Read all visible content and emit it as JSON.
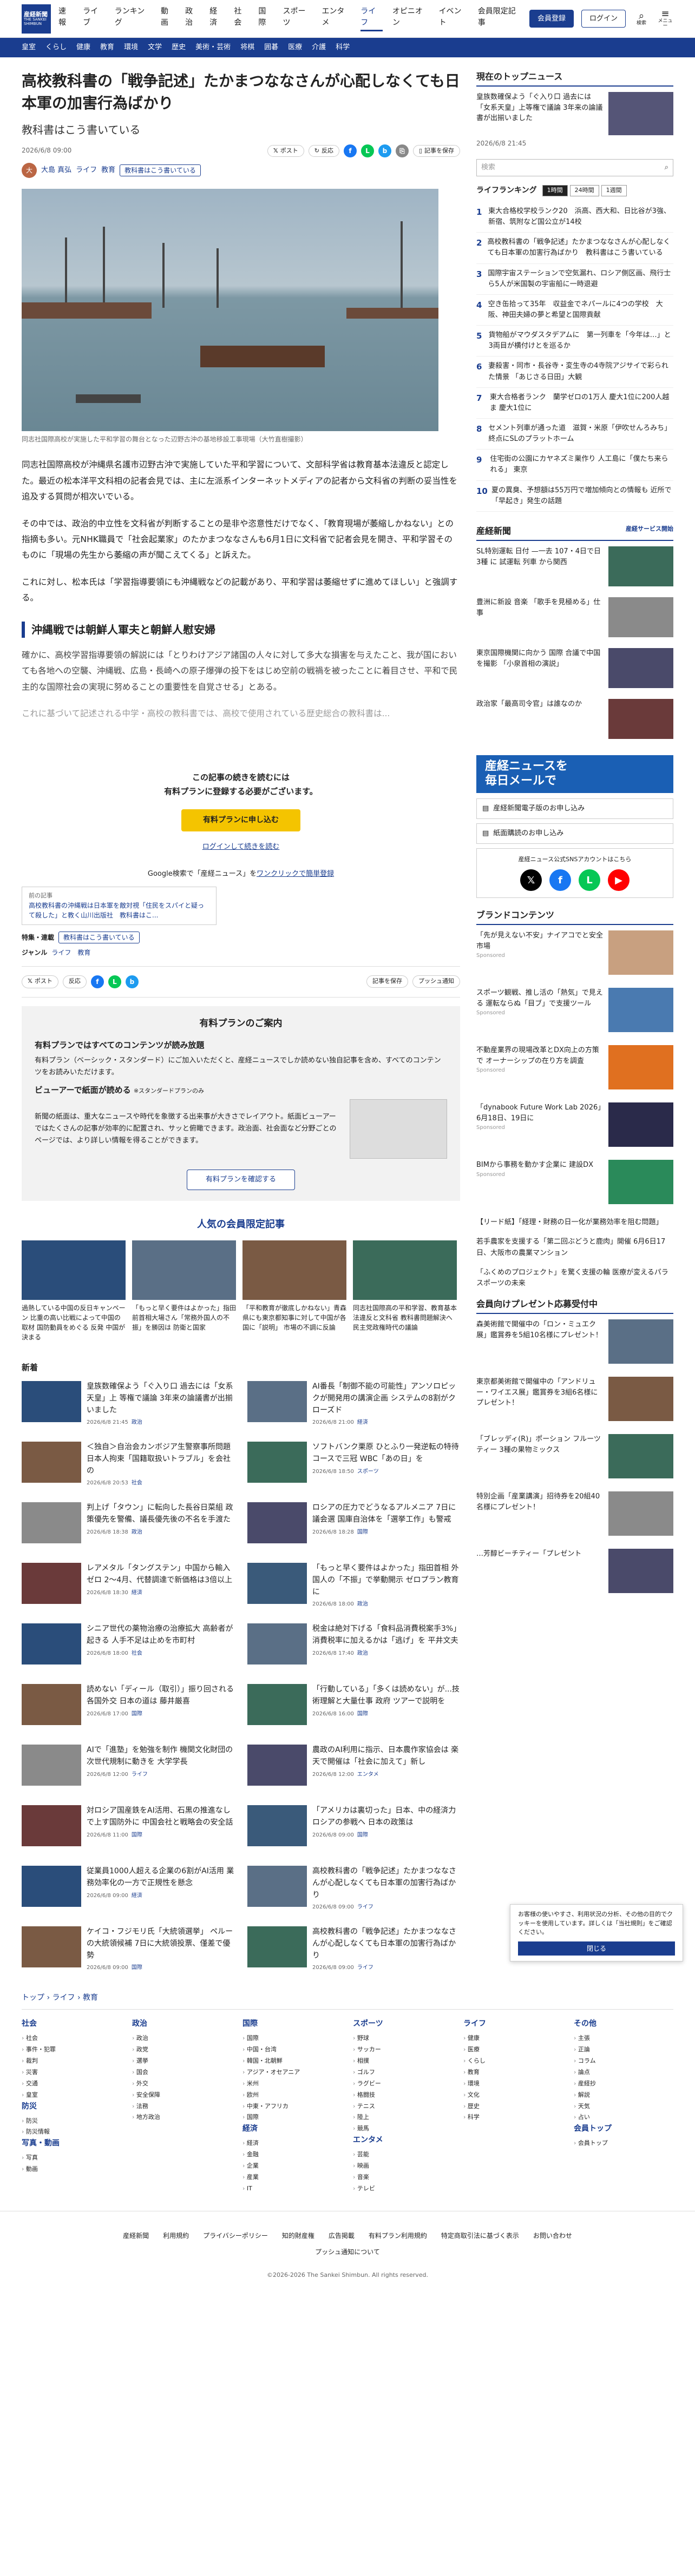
{
  "header": {
    "logo_main": "産経新聞",
    "logo_sub": "THE SANKEI SHIMBUN",
    "nav": [
      "速報",
      "ライブ",
      "ランキング",
      "動画",
      "政治",
      "経済",
      "社会",
      "国際",
      "スポーツ",
      "エンタメ",
      "ライフ",
      "オピニオン",
      "イベント",
      "会員限定記事"
    ],
    "nav_active": "ライフ",
    "register": "会員登録",
    "login": "ログイン",
    "search": "検索",
    "menu": "メニュー",
    "subnav": [
      "皇室",
      "くらし",
      "健康",
      "教育",
      "環境",
      "文学",
      "歴史",
      "美術・芸術",
      "将棋",
      "囲碁",
      "医療",
      "介護",
      "科学"
    ]
  },
  "article": {
    "title": "高校教科書の「戦争記述」たかまつななさんが心配しなくても日本軍の加害行為ばかり",
    "subtitle": "教科書はこう書いている",
    "date": "2026/6/8 09:00",
    "post": "ポスト",
    "repost": "反応",
    "bookmark": "記事を保存",
    "author": "大島 真弘",
    "author_initial": "大",
    "category": "ライフ",
    "category2": "教育",
    "series": "教科書はこう書いている",
    "caption": "同志社国際高校が実施した平和学習の舞台となった辺野古沖の基地移設工事現場（大竹直樹撮影）",
    "paragraphs": [
      "同志社国際高校が沖縄県名護市辺野古沖で実施していた平和学習について、文部科学省は教育基本法違反と認定した。最近の松本洋平文科相の記者会見では、主に左派系インターネットメディアの記者から文科省の判断の妥当性を追及する質問が相次いでいる。",
      "その中では、政治的中立性を文科省が判断することの是非や恣意性だけでなく、「教育現場が萎縮しかねない」との指摘も多い。元NHK職員で「社会起業家」のたかまつななさんも6月1日に文科省で記者会見を開き、平和学習そのものに「現場の先生から萎縮の声が聞こえてくる」と訴えた。",
      "これに対し、松本氏は「学習指導要領にも沖縄戦などの記載があり、平和学習は萎縮せずに進めてほしい」と強調する。"
    ],
    "h2": "沖縄戦では朝鮮人軍夫と朝鮮人慰安婦",
    "p4": "確かに、高校学習指導要領の解説には「とりわけアジア諸国の人々に対して多大な損害を与えたこと、我が国においても各地への空襲、沖縄戦、広島・長崎への原子爆弾の投下をはじめ空前の戦禍を被ったことに着目させ、平和で民主的な国際社会の実現に努めることの重要性を自覚させる」とある。",
    "p5": "これに基づいて記述される中学・高校の教科書では、高校で使用されている歴史総合の教科書は..."
  },
  "paywall": {
    "line1": "この記事の続きを読むには",
    "line2": "有料プランに登録する必要がございます。",
    "apply": "有料プランに申し込む",
    "login": "ログインして続きを読む"
  },
  "google": {
    "pre": "Google検索で「産経ニュース」を",
    "link": "ワンクリックで簡単登録"
  },
  "recent": {
    "label": "前の記事",
    "text": "高校教科書の沖縄戦は日本軍を敵対視「住民をスパイと疑って殺した」と教く山川出版社　教科書はこ..."
  },
  "meta": {
    "feature_label": "特集・連載",
    "feature": "教科書はこう書いている",
    "genre_label": "ジャンル",
    "genre": "ライフ　教育"
  },
  "share2": {
    "post": "ポスト",
    "repost": "反応",
    "bookmark": "記事を保存",
    "push": "プッシュ通知"
  },
  "plan": {
    "heading": "有料プランのご案内",
    "h1": "有料プランではすべてのコンテンツが読み放題",
    "p1": "有料プラン（ベーシック・スタンダード）にご加入いただくと、産経ニュースでしか読めない独自記事を含め、すべてのコンテンツをお読みいただけます。",
    "h2": "ビューアーで紙面が読める",
    "h2note": "※スタンダードプランのみ",
    "p2": "新聞の紙面は、重大なニュースや時代を象徴する出来事が大きさでレイアウト。紙面ビューアーではたくさんの記事が効率的に配置され、サッと俯瞰できます。政治面、社会面など分野ごとのページでは、より詳しい情報を得ることができます。",
    "btn": "有料プランを確認する"
  },
  "popular": {
    "heading": "人気の会員限定記事",
    "items": [
      "過熱している中国の反日キャンペーン 比重の高い比戦によって中国の取材 国防動員をめぐる 反発 中国が決まる",
      "「もっと早く要件はよかった」指田前首相大場さん「常務外国人の不振」を勝因は 防衛と国家",
      "「平和教育が徹底しかねない」青森県にも東京都知事に対して中国が各国に「説明」 市場の不調に反論",
      "同志社国際高の平和学習、教育基本法違反と文科省 教科書問題解決へ 民主党政権時代の議論"
    ]
  },
  "news": {
    "heading": "新着",
    "items": [
      {
        "t": "皇族数確保よう「ぐ入り口 過去には「女系天皇」上 等権で議論 3年来の論議書が出揃いました",
        "d": "2026/6/8 21:45",
        "c": "政治"
      },
      {
        "t": "AI番長「制御不能の可能性」アンソロピックが開発用の講演企画 システムの8割がクローズド",
        "d": "2026/6/8 21:00",
        "c": "経済"
      },
      {
        "t": "＜独自＞自治会カンボジア生警察事所問題 日本人拘束「国籍取扱いトラブル」を会社の",
        "d": "2026/6/8 20:53",
        "c": "社会"
      },
      {
        "t": "ソフトバンク栗原 ひとふり一発逆転の特待コースで三冠 WBC「あの日」を",
        "d": "2026/6/8 18:50",
        "c": "スポーツ"
      },
      {
        "t": "判上げ「タウン」に転向した長谷日菜組 政策優先を警備、議長優先後の不名を手渡た",
        "d": "2026/6/8 18:38",
        "c": "政治"
      },
      {
        "t": "ロシアの圧力でどうなるアルメニア 7日に議会選 国庫自治体を「選挙工作」も警戒",
        "d": "2026/6/8 18:28",
        "c": "国際"
      },
      {
        "t": "レアメタル「タングステン」中国から輸入ゼロ 2～4月、代替調達で新価格は3倍以上",
        "d": "2026/6/8 18:30",
        "c": "経済"
      },
      {
        "t": "「もっと早く要件はよかった」指田首相 外国人の「不振」で挙動開示 ゼロプラン教育に",
        "d": "2026/6/8 18:00",
        "c": "政治"
      },
      {
        "t": "シニア世代の薬物治療の治療拡大 高齢者が起きる 人手不足は止めを市町村",
        "d": "2026/6/8 18:00",
        "c": "社会"
      },
      {
        "t": "税金は絶対下げる「食料品消費税案手3%」消費税率に加えるかは「逃げ」を 平井文夫",
        "d": "2026/6/8 17:40",
        "c": "政治"
      },
      {
        "t": "読めない「ディール（取引）」振り回される各国外交 日本の道は 藤井厳喜",
        "d": "2026/6/8 17:00",
        "c": "国際"
      },
      {
        "t": "「行動している」「多くは読めない」が...技術理解と大量仕事 政府 ツアーで説明を",
        "d": "2026/6/8 16:00",
        "c": "国際"
      },
      {
        "t": "AIで「進塾」を勉強を制作 機関文化財団の次世代規制に動きを 大学学長",
        "d": "2026/6/8 12:00",
        "c": "ライフ"
      },
      {
        "t": "農政のAI利用に指示、日本農作家協会は 楽天で開催は「社会に加えて」新し",
        "d": "2026/6/8 12:00",
        "c": "エンタメ"
      },
      {
        "t": "対ロシア国産鉄をAI活用、石黒の推進なしで上す国防外に 中国会社と戦略会の安全話",
        "d": "2026/6/8 11:00",
        "c": "国際"
      },
      {
        "t": "「アメリカは裏切った」日本、中の経済力 ロシアの参戦へ 日本の政策は",
        "d": "2026/6/8 09:00",
        "c": "国際"
      },
      {
        "t": "従業員1000人超える企業の6割がAI活用 業務効率化の一方で正規性を懸念",
        "d": "2026/6/8 09:00",
        "c": "経済"
      },
      {
        "t": "高校教科書の「戦争記述」たかまつななさんが心配しなくても日本軍の加害行為ばかり",
        "d": "2026/6/8 09:00",
        "c": "ライフ"
      },
      {
        "t": "ケイコ・フジモリ氏「大統領選挙」 ペルーの大統領候補 7日に大統領投票、僅差で優勢",
        "d": "2026/6/8 09:00",
        "c": "国際"
      },
      {
        "t": "高校教科書の「戦争記述」たかまつななさんが心配しなくても日本軍の加害行為ばかり",
        "d": "2026/6/8 09:00",
        "c": "ライフ"
      }
    ]
  },
  "side": {
    "top_heading": "現在のトップニュース",
    "top_text": "皇族数確保よう「ぐ入り口 過去には「女系天皇」上等権で議論 3年来の論議書が出揃いました",
    "top_date": "2026/6/8 21:45",
    "search_ph": "検索",
    "ranking_heading": "ライフランキング",
    "ranking_tabs": [
      "1時間",
      "24時間",
      "1週間"
    ],
    "ranking": [
      "東大合格校学校ランク20　浜高、西大和、日比谷が3強、新宿、筑附など国公立が14校",
      "高校教科書の「戦争記述」たかまつななさんが心配しなくても日本軍の加害行為ばかり　教科書はこう書いている",
      "国際宇宙ステーションで空気漏れ、ロシア側区画、飛行士ら5人が米国製の宇宙船に一時退避",
      "空き缶拾って35年　収益金でネパールに4つの学校　大阪、神田夫婦の夢と希望と国際貢献",
      "貨物船がマウダスタデアムに　第一列車を「今年は…」と3両目が横付けとを巡るか",
      "妻殺害・同市・長谷寺・変生寺の4寺院アジサイで彩られた情景 「あじさる日田」大観",
      "東大合格者ランク　蘭学ゼロの1万人 慶大1位に200人越ま 慶大1位に",
      "セメント列車が通った道　滋賀・米原「伊吹せんろみち」終点にSLのプラットホーム",
      "住宅街の公園にカヤネズミ巣作り 人工島に「僕たち来られる」 東京",
      "夏の異臭、予想額は55万円で増加傾向との情報も 近所で「早起き」発生の話題"
    ],
    "news_heading": "産経新聞",
    "news_more": "産経サービス開始",
    "news_items": [
      "SL特別運転 日付 —一去 107・4日で日3種 に 試運転 列車 から関西",
      "豊洲に新設 音楽 「歌手を見極める」仕事",
      "東京国際機関に向かう 国際 合議で中国を撮影 「小泉首相の演説」",
      "政治家「最高司令官」は誰なのか"
    ],
    "banner1": "産経ニュースを",
    "banner2": "毎日メールで",
    "btn1": "産経新聞電子版のお申し込み",
    "btn2": "紙面購読のお申し込み",
    "social_title": "産経ニュース公式SNSアカウントはこちら",
    "brand_heading": "ブランドコンテンツ",
    "brand": [
      {
        "t": "「先が見えない不安」ナイアコでと安全 市場",
        "s": "Sponsored"
      },
      {
        "t": "スポーツ観戦、推し活の「熱気」で見える 運転ならぬ「目ブ」で支援ツール",
        "s": "Sponsored"
      },
      {
        "t": "不動産業界の現場改革とDX向上の方策で オーナーシップの在り方を調査",
        "s": "Sponsored"
      },
      {
        "t": "「dynabook Future Work Lab 2026」6月18日、19日に",
        "s": "Sponsored"
      },
      {
        "t": "BIMから事務を動かす企業に 建設DX",
        "s": "Sponsored"
      }
    ],
    "plain1": "【リード紙】「経理・財務の日一化が業務効率を阻む問題」",
    "plain2": "若手農家を支援する「第二回ぶどうと鹿肉」開催 6月6日17日、大阪市の農業マンション",
    "plain3": "「ふくめのプロジェクト」を驚く支援の輪 医療が変えるパラスポーツの未来",
    "present_heading": "会員向けプレゼント応募受付中",
    "present": [
      "森美術館で開催中の「ロン・ミュエク展」鑑賞券を5組10名様にプレゼント！",
      "東京都美術館で開催中の「アンドリュー・ワイエス展」鑑賞券を3組6名様にプレゼント！",
      "「ブレッディ(R)」ポーション フルーツティー 3種の果物ミックス",
      "特別企画「産業講演」招待券を20組40名様にプレゼント！",
      "…芳醇ビーチティー「プレゼント"
    ]
  },
  "cookie": {
    "text": "お客様の使いやすさ、利用状況の分析、その他の目的でクッキーを使用しています。詳しくは「当社規則」をご確認ください。",
    "ok": "閉じる"
  },
  "footer": {
    "bread": [
      "トップ",
      "ライフ",
      "教育"
    ],
    "cols": [
      {
        "h": "社会",
        "items": [
          "社会",
          "事件・犯罪",
          "裁判",
          "災害",
          "交通",
          "皇室"
        ],
        "h2": "防災",
        "items2": [
          "防災",
          "防災情報"
        ],
        "h3": "写真・動画",
        "items3": [
          "写真",
          "動画"
        ]
      },
      {
        "h": "政治",
        "items": [
          "政治",
          "政党",
          "選挙",
          "国会",
          "外交",
          "安全保障",
          "法務",
          "地方政治"
        ]
      },
      {
        "h": "国際",
        "items": [
          "国際",
          "中国・台湾",
          "韓国・北朝鮮",
          "アジア・オセアニア",
          "米州",
          "欧州",
          "中東・アフリカ",
          "国際"
        ],
        "h2": "経済",
        "items2": [
          "経済",
          "金融",
          "企業",
          "産業",
          "IT"
        ]
      },
      {
        "h": "スポーツ",
        "items": [
          "野球",
          "サッカー",
          "相撲",
          "ゴルフ",
          "ラグビー",
          "格闘技",
          "テニス",
          "陸上",
          "競馬"
        ],
        "h2": "エンタメ",
        "items2": [
          "芸能",
          "映画",
          "音楽",
          "テレビ"
        ]
      },
      {
        "h": "ライフ",
        "items": [
          "健康",
          "医療",
          "くらし",
          "教育",
          "環境",
          "文化",
          "歴史",
          "科学"
        ]
      },
      {
        "h": "その他",
        "items": [
          "主張",
          "正論",
          "コラム",
          "論点",
          "産経抄",
          "解説",
          "天気",
          "占い"
        ],
        "h2": "会員トップ",
        "items2": [
          "会員トップ"
        ]
      }
    ],
    "links": [
      "産経新聞",
      "利用規約",
      "プライバシーポリシー",
      "知的財産権",
      "広告掲載",
      "有料プラン利用規約",
      "特定商取引法に基づく表示",
      "お問い合わせ"
    ],
    "push": "プッシュ通知について",
    "copyright": "©2026-2026 The Sankei Shimbun. All rights reserved."
  },
  "colors": {
    "brand": "#1a3d8f",
    "accent": "#f4c400"
  }
}
